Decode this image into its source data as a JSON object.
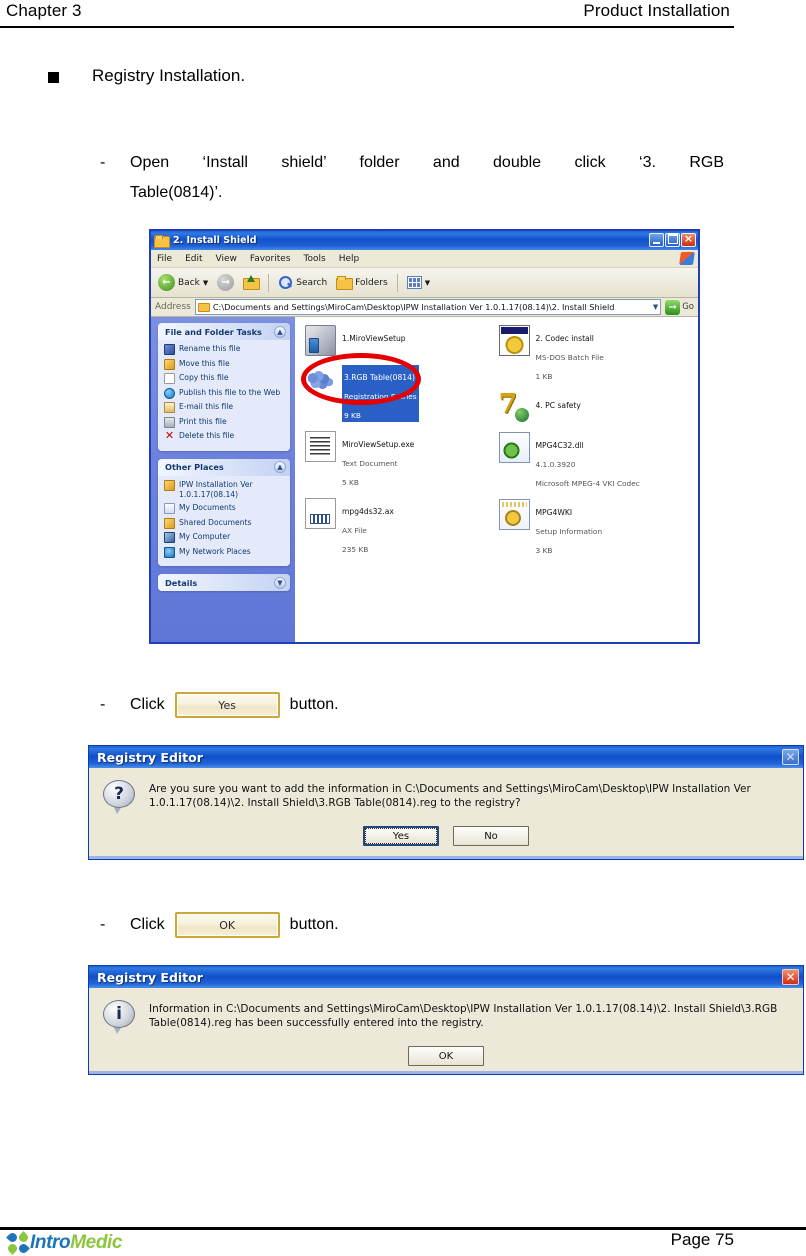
{
  "page_header": {
    "left": "Chapter 3",
    "right": "Product Installation"
  },
  "section": {
    "bullet_title": "Registry Installation."
  },
  "steps": [
    {
      "dash": "-",
      "line1": "Open  ‘Install  shield’  folder  and  double  click  ‘3.  RGB",
      "line2": "Table(0814)’."
    },
    {
      "dash": "-",
      "prefix": "Click",
      "button_label": "Yes",
      "suffix": "button."
    },
    {
      "dash": "-",
      "prefix": "Click",
      "button_label": "OK",
      "suffix": "button."
    }
  ],
  "explorer": {
    "title": "2. Install Shield",
    "window_buttons": {
      "minimize": "minimize-icon",
      "maximize": "maximize-icon",
      "close": "close-icon"
    },
    "menu": [
      "File",
      "Edit",
      "View",
      "Favorites",
      "Tools",
      "Help"
    ],
    "toolbar": {
      "back": "Back",
      "forward": "forward-icon",
      "up": "up-icon",
      "search": "Search",
      "folders": "Folders",
      "views": "views-icon"
    },
    "address": {
      "label": "Address",
      "value": "C:\\Documents and Settings\\MiroCam\\Desktop\\IPW Installation Ver 1.0.1.17(08.14)\\2. Install Shield",
      "go": "Go"
    },
    "panels": [
      {
        "title": "File and Folder Tasks",
        "collapse": "collapse-icon",
        "items": [
          {
            "icon": "rename",
            "label": "Rename this file"
          },
          {
            "icon": "move",
            "label": "Move this file"
          },
          {
            "icon": "copy",
            "label": "Copy this file"
          },
          {
            "icon": "publish",
            "label": "Publish this file to the Web"
          },
          {
            "icon": "email",
            "label": "E-mail this file"
          },
          {
            "icon": "print",
            "label": "Print this file"
          },
          {
            "icon": "del",
            "label": "Delete this file"
          }
        ]
      },
      {
        "title": "Other Places",
        "collapse": "collapse-icon",
        "items": [
          {
            "icon": "folder",
            "label": "IPW Installation Ver 1.0.1.17(08.14)"
          },
          {
            "icon": "mydocs",
            "label": "My Documents"
          },
          {
            "icon": "folder",
            "label": "Shared Documents"
          },
          {
            "icon": "comp",
            "label": "My Computer"
          },
          {
            "icon": "net",
            "label": "My Network Places"
          }
        ]
      },
      {
        "title": "Details",
        "collapse": "expand-icon",
        "items": []
      }
    ],
    "files_left": [
      {
        "icon": "ic-setup",
        "name": "1.MiroViewSetup",
        "lines": [],
        "selected": false
      },
      {
        "icon": "ic-reg",
        "name": "3.RGB Table(0814)",
        "lines": [
          "Registration Entries",
          "9 KB"
        ],
        "selected": true
      },
      {
        "icon": "ic-doc",
        "name": "MiroViewSetup.exe",
        "lines": [
          "Text Document",
          "5 KB"
        ],
        "selected": false
      },
      {
        "icon": "ic-ax",
        "name": "mpg4ds32.ax",
        "lines": [
          "AX File",
          "235 KB"
        ],
        "selected": false
      }
    ],
    "files_right": [
      {
        "icon": "ic-bat",
        "name": "2. Codec install",
        "lines": [
          "MS-DOS Batch File",
          "1 KB"
        ],
        "selected": false
      },
      {
        "icon": "ic-pc",
        "name": "4. PC safety",
        "lines": [],
        "selected": false
      },
      {
        "icon": "ic-dll",
        "name": "MPG4C32.dll",
        "lines": [
          "4.1.0.3920",
          "Microsoft MPEG-4 VKI Codec"
        ],
        "selected": false
      },
      {
        "icon": "ic-inf",
        "name": "MPG4WKI",
        "lines": [
          "Setup Information",
          "3 KB"
        ],
        "selected": false
      }
    ],
    "annotation": "red-ellipse-highlight"
  },
  "dialog_confirm": {
    "title": "Registry Editor",
    "close": "close-icon",
    "icon": "question-icon",
    "icon_glyph": "?",
    "message": "Are you sure you want to add the information in C:\\Documents and Settings\\MiroCam\\Desktop\\IPW Installation Ver 1.0.1.17(08.14)\\2. Install Shield\\3.RGB Table(0814).reg to the registry?",
    "buttons": [
      {
        "label": "Yes",
        "focused": true
      },
      {
        "label": "No",
        "focused": false
      }
    ]
  },
  "dialog_info": {
    "title": "Registry Editor",
    "close": "close-icon",
    "icon": "information-icon",
    "icon_glyph": "i",
    "message": "Information in C:\\Documents and Settings\\MiroCam\\Desktop\\IPW Installation Ver 1.0.1.17(08.14)\\2. Install Shield\\3.RGB Table(0814).reg has been successfully entered into the registry.",
    "buttons": [
      {
        "label": "OK",
        "focused": false
      }
    ]
  },
  "footer": {
    "logo_part1": "Intro",
    "logo_part2": "Medic",
    "page": "Page 75"
  },
  "colors": {
    "xp_blue": "#1b62d6",
    "annotation_red": "#e60000",
    "logo_blue": "#1b75bb",
    "logo_green": "#8cc63f"
  }
}
